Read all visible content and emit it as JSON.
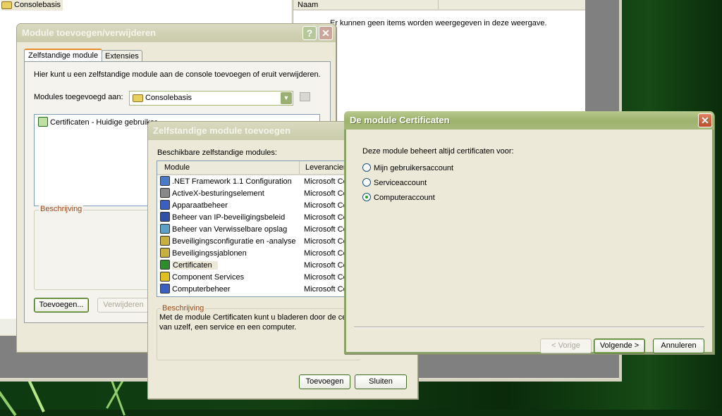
{
  "console": {
    "tree_item": "Consolebasis",
    "column_name": "Naam",
    "empty_message": "Er kunnen geen items worden weergegeven in deze weergave."
  },
  "dialog_addremove": {
    "title": "Module toevoegen/verwijderen",
    "tabs": [
      {
        "label": "Zelfstandige module",
        "selected": true
      },
      {
        "label": "Extensies",
        "selected": false
      }
    ],
    "intro": "Hier kunt u een zelfstandige module aan de console toevoegen of eruit verwijderen.",
    "added_to_label": "Modules toegevoegd aan:",
    "added_to_value": "Consolebasis",
    "modules": [
      "Certificaten - Huidige gebruiker"
    ],
    "description_label": "Beschrijving",
    "add_button": "Toevoegen...",
    "remove_button": "Verwijderen"
  },
  "dialog_standalone": {
    "title": "Zelfstandige module toevoegen",
    "available_label": "Beschikbare zelfstandige modules:",
    "columns": [
      "Module",
      "Leverancier"
    ],
    "rows": [
      {
        "module": ".NET Framework 1.1 Configuration",
        "vendor": "Microsoft Co",
        "icon": "net-config-icon",
        "color": "#4a7bc8"
      },
      {
        "module": "ActiveX-besturingselement",
        "vendor": "Microsoft Co",
        "icon": "activex-icon",
        "color": "#888888"
      },
      {
        "module": "Apparaatbeheer",
        "vendor": "Microsoft Co",
        "icon": "device-manager-icon",
        "color": "#3a5fc0"
      },
      {
        "module": "Beheer van IP-beveiligingsbeleid",
        "vendor": "Microsoft Co",
        "icon": "ip-security-icon",
        "color": "#2f4fa8"
      },
      {
        "module": "Beheer van Verwisselbare opslag",
        "vendor": "Microsoft Co",
        "icon": "removable-storage-icon",
        "color": "#5aa0c8"
      },
      {
        "module": "Beveiligingsconfiguratie en -analyse",
        "vendor": "Microsoft Co",
        "icon": "security-config-icon",
        "color": "#c8b040"
      },
      {
        "module": "Beveiligingssjablonen",
        "vendor": "Microsoft Co",
        "icon": "security-templates-icon",
        "color": "#c8b040"
      },
      {
        "module": "Certificaten",
        "vendor": "Microsoft Co",
        "icon": "certificates-icon",
        "color": "#2e8b2e",
        "selected": true
      },
      {
        "module": "Component Services",
        "vendor": "Microsoft Co",
        "icon": "component-services-icon",
        "color": "#e0c020"
      },
      {
        "module": "Computerbeheer",
        "vendor": "Microsoft Co",
        "icon": "computer-management-icon",
        "color": "#3a5fc0"
      }
    ],
    "description_label": "Beschrijving",
    "description_text": "Met de module Certificaten kunt u bladeren door de cert",
    "description_text2": "van uzelf, een service en een computer.",
    "add_button": "Toevoegen",
    "close_button": "Sluiten"
  },
  "dialog_certificates": {
    "title": "De module Certificaten",
    "prompt": "Deze module beheert altijd certificaten voor:",
    "options": [
      {
        "label": "Mijn gebruikersaccount",
        "checked": false
      },
      {
        "label": "Serviceaccount",
        "checked": false
      },
      {
        "label": "Computeraccount",
        "checked": true
      }
    ],
    "back_button": "< Vorige",
    "next_button": "Volgende >",
    "cancel_button": "Annuleren"
  }
}
